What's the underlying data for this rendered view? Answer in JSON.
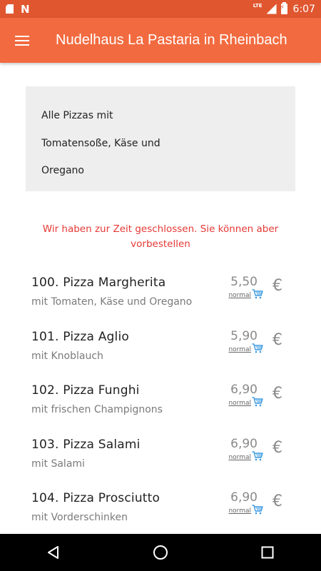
{
  "status_bar": {
    "time": "6:07",
    "network": "LTE"
  },
  "app_bar": {
    "title": "Nudelhaus La Pastaria in Rheinbach"
  },
  "info_box": {
    "lines": [
      "Alle Pizzas mit",
      "Tomatensoße, Käse und",
      "Oregano"
    ]
  },
  "notice": {
    "text": "Wir haben zur Zeit geschlossen. Sie können aber vorbestellen"
  },
  "menu_items": [
    {
      "name": "100. Pizza Margherita",
      "description": "mit Tomaten, Käse und Oregano",
      "price": "5,50",
      "size": "normal",
      "currency": "€"
    },
    {
      "name": "101. Pizza Aglio",
      "description": "mit Knoblauch",
      "price": "5,90",
      "size": "normal",
      "currency": "€"
    },
    {
      "name": "102. Pizza Funghi",
      "description": "mit frischen Champignons",
      "price": "6,90",
      "size": "normal",
      "currency": "€"
    },
    {
      "name": "103. Pizza Salami",
      "description": "mit Salami",
      "price": "6,90",
      "size": "normal",
      "currency": "€"
    },
    {
      "name": "104. Pizza Prosciutto",
      "description": "mit Vorderschinken",
      "price": "6,90",
      "size": "normal",
      "currency": "€"
    }
  ],
  "colors": {
    "status_bar": "#e0562f",
    "app_bar": "#f26a3f",
    "notice": "#e53935",
    "cart": "#3b9ae1"
  },
  "icons": {
    "menu": "hamburger-icon",
    "cart": "shopping-cart-icon",
    "back": "back-triangle-icon",
    "home": "home-circle-icon",
    "recents": "recents-square-icon"
  }
}
